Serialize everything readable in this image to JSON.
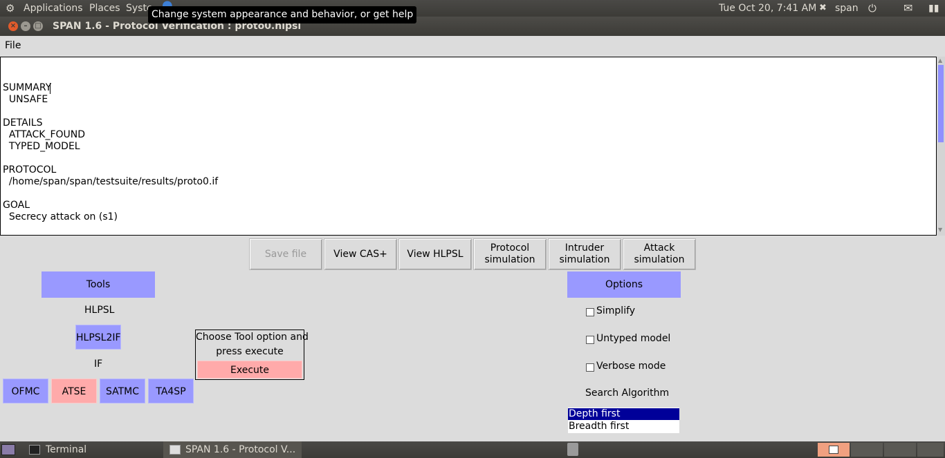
{
  "top_panel": {
    "applications": "Applications",
    "places": "Places",
    "system": "Syste",
    "tooltip": "Change system appearance and behavior, or get help",
    "datetime": "Tue Oct 20,  7:41 AM",
    "user": "span"
  },
  "window": {
    "title": "SPAN 1.6 - Protocol Verification : proto0.hlpsl"
  },
  "menu": {
    "file": "File"
  },
  "output": {
    "lines": [
      "SUMMARY",
      "  UNSAFE",
      "",
      "DETAILS",
      "  ATTACK_FOUND",
      "  TYPED_MODEL",
      "",
      "PROTOCOL",
      "  /home/span/span/testsuite/results/proto0.if",
      "",
      "GOAL",
      "  Secrecy attack on (s1)"
    ]
  },
  "actions": {
    "save_file": "Save file",
    "view_cas": "View CAS+",
    "view_hlpsl": "View HLPSL",
    "protocol_sim_1": "Protocol",
    "protocol_sim_2": "simulation",
    "intruder_sim_1": "Intruder",
    "intruder_sim_2": "simulation",
    "attack_sim_1": "Attack",
    "attack_sim_2": "simulation"
  },
  "tools": {
    "header": "Tools",
    "hlpsl_label": "HLPSL",
    "hlpsl2if": "HLPSL2IF",
    "if_label": "IF",
    "ofmc": "OFMC",
    "atse": "ATSE",
    "satmc": "SATMC",
    "ta4sp": "TA4SP"
  },
  "execute_box": {
    "line1": "Choose Tool option and",
    "line2": "press execute",
    "execute": "Execute"
  },
  "options": {
    "header": "Options",
    "simplify": "Simplify",
    "untyped": "Untyped model",
    "verbose": "Verbose mode",
    "search_algorithm": "Search Algorithm",
    "depth_first": "Depth first",
    "breadth_first": "Breadth first"
  },
  "bottom_panel": {
    "terminal": "Terminal",
    "span_task": "SPAN 1.6 - Protocol V..."
  },
  "colors": {
    "tool_blue": "#9999ff",
    "selected_tool": "#ffaaaa",
    "execute": "#ffaaaa",
    "listbox_selected": "#000099"
  }
}
